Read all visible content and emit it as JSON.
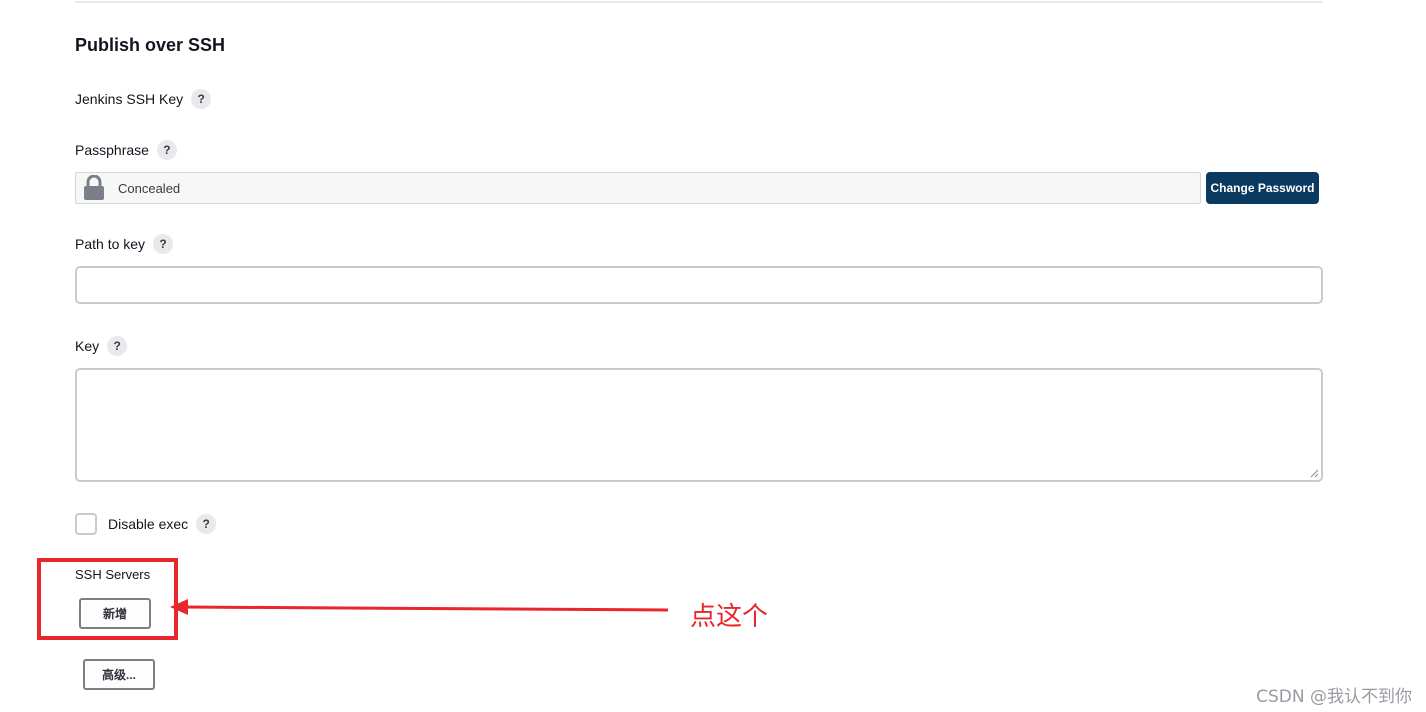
{
  "section": {
    "title": "Publish over SSH"
  },
  "fields": {
    "jenkins_ssh_key": {
      "label": "Jenkins SSH Key"
    },
    "passphrase": {
      "label": "Passphrase",
      "value": "Concealed",
      "change_label": "Change Password"
    },
    "path_to_key": {
      "label": "Path to key",
      "value": ""
    },
    "key": {
      "label": "Key",
      "value": ""
    },
    "disable_exec": {
      "label": "Disable exec",
      "checked": false
    }
  },
  "help_glyph": "?",
  "ssh_servers": {
    "label": "SSH Servers",
    "add_label": "新增"
  },
  "advanced": {
    "label": "高级..."
  },
  "annotation": {
    "text": "点这个",
    "color": "#e8262d"
  },
  "watermark": "CSDN @我认不到你",
  "colors": {
    "primary_button": "#0b3a61",
    "annotation_red": "#e8262d"
  }
}
